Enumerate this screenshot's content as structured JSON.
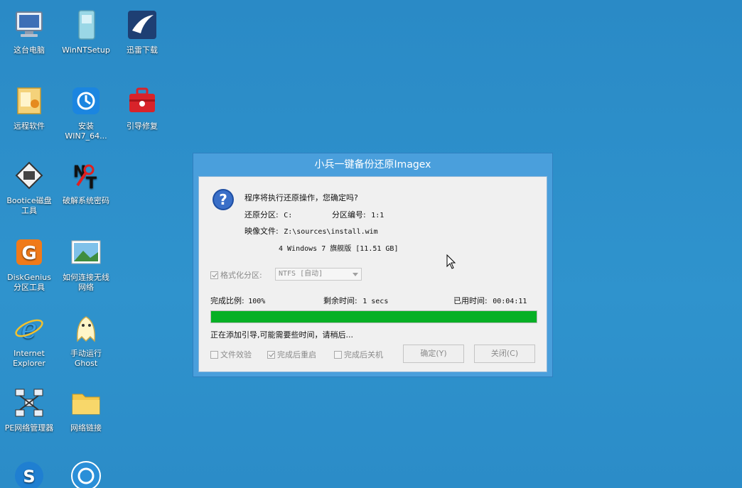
{
  "desktop": {
    "icons": [
      {
        "label": "这台电脑"
      },
      {
        "label": "WinNTSetup"
      },
      {
        "label": "迅雷下载"
      },
      {
        "label": "远程软件"
      },
      {
        "label": "安装\nWIN7_64..."
      },
      {
        "label": "引导修复"
      },
      {
        "label": "Bootice磁盘\n工具"
      },
      {
        "label": "破解系统密码"
      },
      {
        "label": "DiskGenius\n分区工具"
      },
      {
        "label": "如何连接无线\n网络"
      },
      {
        "label": "Internet\nExplorer"
      },
      {
        "label": "手动运行\nGhost"
      },
      {
        "label": "PE网络管理器"
      },
      {
        "label": "网络链接"
      }
    ]
  },
  "dialog": {
    "title": "小兵一键备份还原Imagex",
    "question": "程序将执行还原操作，您确定吗?",
    "restore_partition_label": "还原分区:",
    "restore_partition_value": "C:",
    "partition_number_label": "分区编号:",
    "partition_number_value": "1:1",
    "image_file_label": "映像文件:",
    "image_file_value": "Z:\\sources\\install.wim",
    "image_edition": "4 Windows 7 旗舰版 [11.51 GB]",
    "format_partition_label": "格式化分区:",
    "filesystem_value": "NTFS [自动]",
    "completion_label": "完成比例:",
    "completion_value": "100%",
    "remaining_label": "剩余时间:",
    "remaining_value": "1 secs",
    "elapsed_label": "已用时间:",
    "elapsed_value": "00:04:11",
    "progress_percent": 100,
    "status_text": "正在添加引导,可能需要些时间，请稍后...",
    "file_verify_label": "文件效验",
    "reboot_after_label": "完成后重启",
    "shutdown_after_label": "完成后关机",
    "ok_label": "确定(Y)",
    "close_label": "关闭(C)"
  },
  "colors": {
    "desktop_bg": "#2d8fc9",
    "progress_fill": "#06b025",
    "title_bar": "#4a9fdc"
  }
}
